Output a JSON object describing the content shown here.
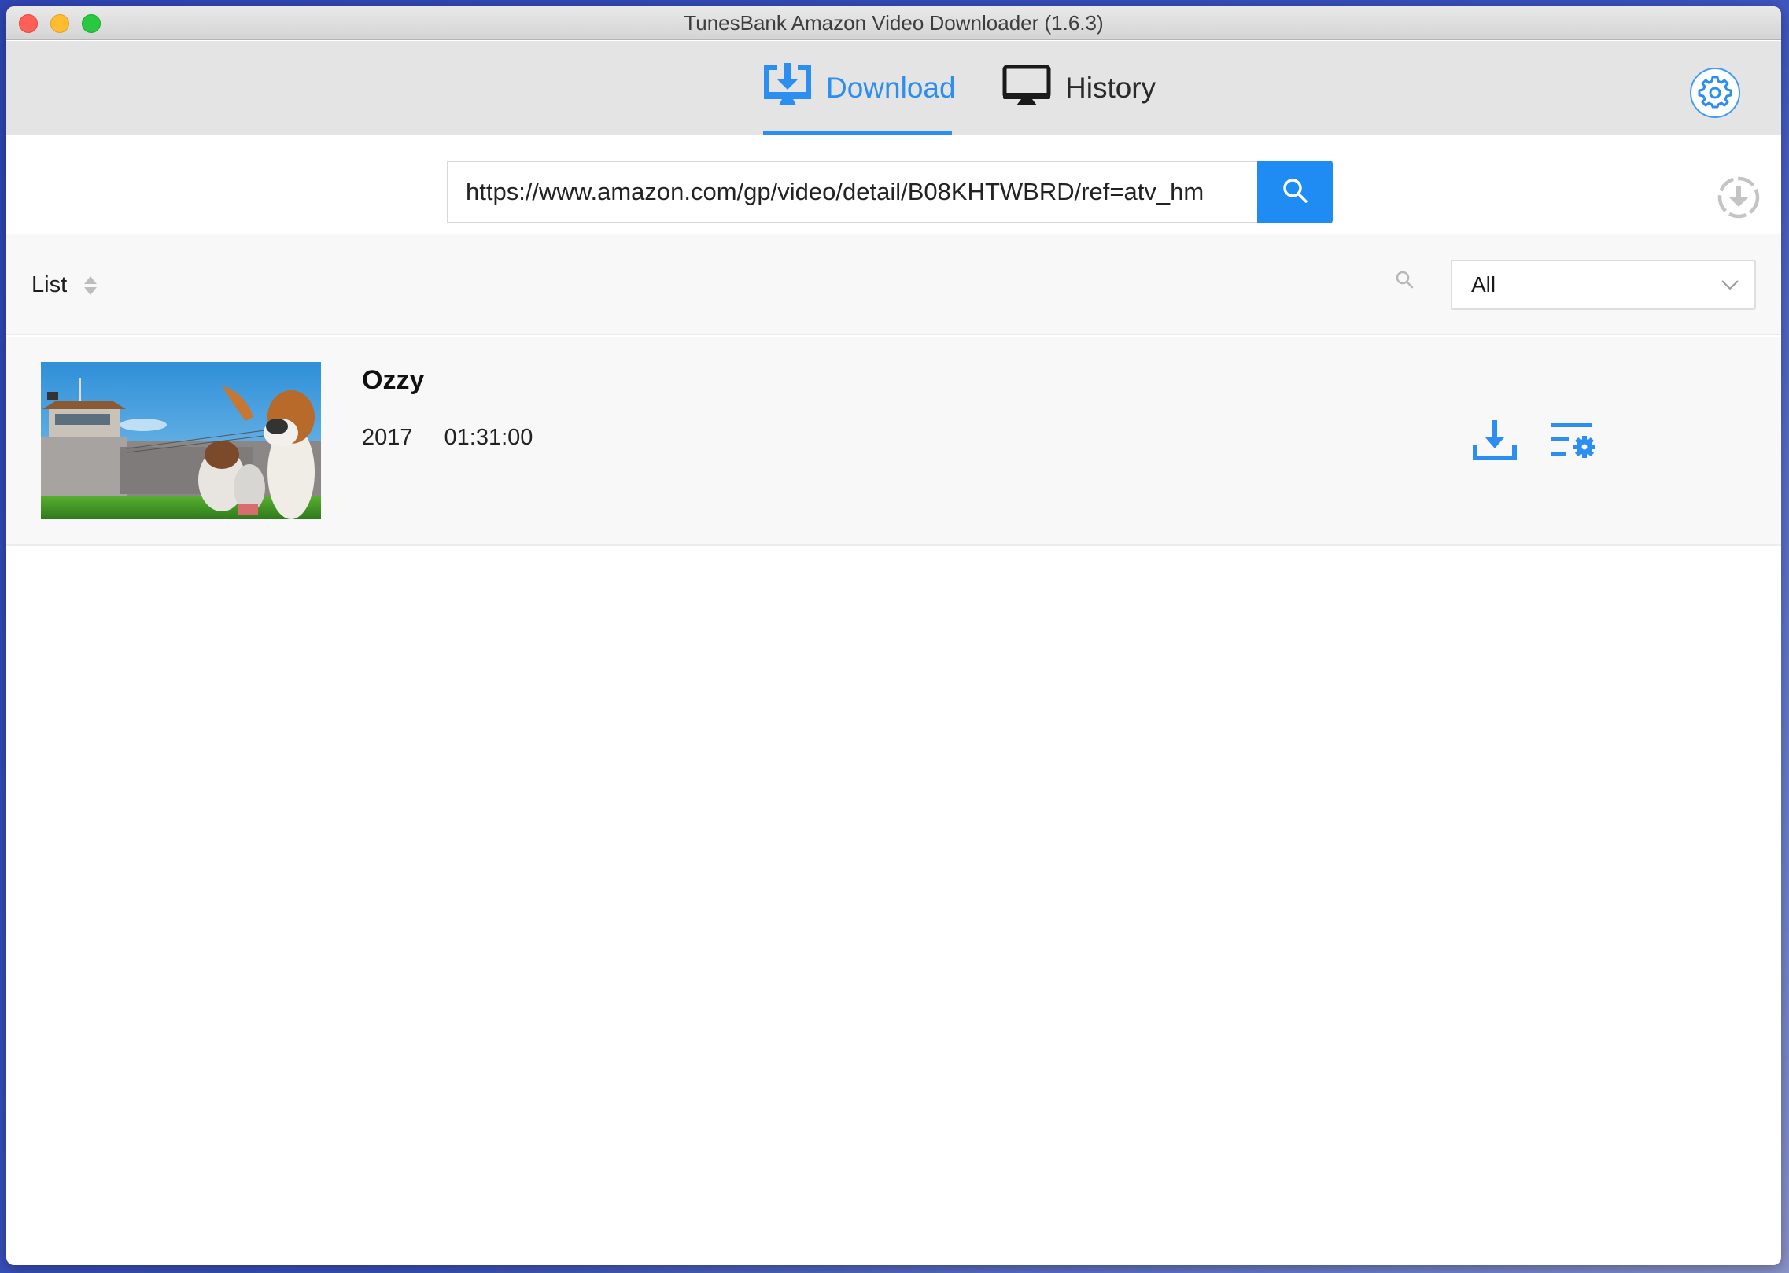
{
  "window": {
    "title": "TunesBank Amazon Video Downloader (1.6.3)"
  },
  "toolbar": {
    "tabs": [
      {
        "id": "download",
        "label": "Download",
        "icon": "monitor-download-icon",
        "active": true
      },
      {
        "id": "history",
        "label": "History",
        "icon": "monitor-icon",
        "active": false
      }
    ],
    "settings_icon": "gear-icon"
  },
  "search": {
    "url_value": "https://www.amazon.com/gp/video/detail/B08KHTWBRD/ref=atv_hm",
    "button_icon": "search-icon",
    "queue_icon": "download-queue-icon"
  },
  "list": {
    "label": "List",
    "sort_icon": "sort-icon",
    "filter_search_icon": "search-icon",
    "filter": {
      "selected": "All"
    }
  },
  "videos": [
    {
      "title": "Ozzy",
      "year": "2017",
      "duration": "01:31:00",
      "thumbnail": "ozzy-poster",
      "actions": [
        "download-icon",
        "download-settings-icon"
      ]
    }
  ],
  "colors": {
    "accent": "#2b8ef0",
    "toolbar_bg": "#e4e4e4",
    "list_bg": "#f8f8f8"
  }
}
